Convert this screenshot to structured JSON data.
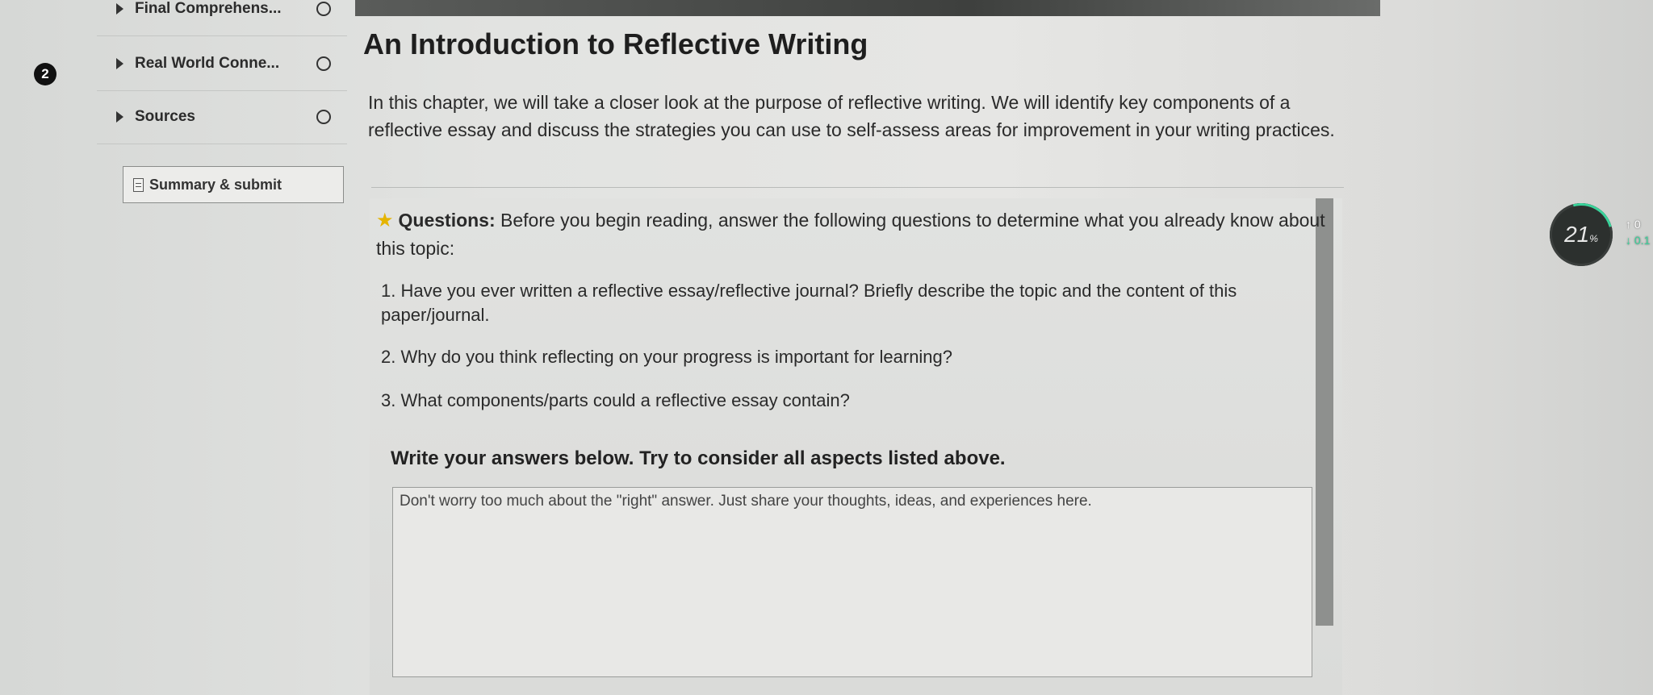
{
  "step_badge": "2",
  "sidebar": {
    "items": [
      {
        "label": "Final Comprehens..."
      },
      {
        "label": "Real World Conne..."
      },
      {
        "label": "Sources"
      }
    ],
    "summary_label": "Summary & submit"
  },
  "main": {
    "title": "An Introduction to Reflective Writing",
    "intro": "In this chapter, we will take a closer look at the purpose of reflective writing. We will identify key components of a reflective essay and discuss the strategies you can use to self-assess areas for improvement in your writing practices.",
    "questions_label": "Questions:",
    "questions_text": " Before you begin reading, answer the following questions to determine what you already know about this topic:",
    "questions": [
      "1. Have you ever written a reflective essay/reflective journal? Briefly describe the topic and the content of this paper/journal.",
      "2. Why do you think reflecting on your progress is important for learning?",
      "3. What components/parts could a reflective essay contain?"
    ],
    "answers_heading": "Write your answers below. Try to consider all aspects listed above.",
    "answer_placeholder": "Don't worry too much about the \"right\" answer. Just share your thoughts, ideas, and experiences here."
  },
  "overlay": {
    "gauge_value": "21",
    "gauge_unit": "%",
    "net_up": "0",
    "net_down": "0.1"
  },
  "colors": {
    "accent_star": "#e5b400",
    "gauge_arc": "#39d29a"
  }
}
